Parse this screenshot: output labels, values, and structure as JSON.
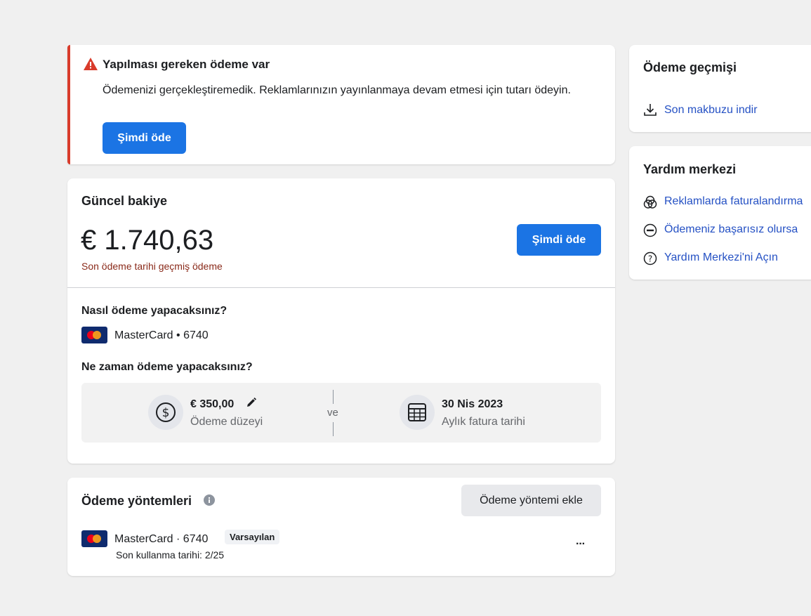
{
  "alert": {
    "title": "Yapılması gereken ödeme var",
    "message": "Ödemenizi gerçekleştiremedik. Reklamlarınızın yayınlanmaya devam etmesi için tutarı ödeyin.",
    "button": "Şimdi öde",
    "accent_color": "#d93b2b"
  },
  "balance": {
    "title": "Güncel bakiye",
    "amount": "€ 1.740,63",
    "status": "Son ödeme tarihi geçmiş ödeme",
    "button": "Şimdi öde",
    "how_title": "Nasıl ödeme yapacaksınız?",
    "card_label": "MasterCard • 6740",
    "when_title": "Ne zaman ödeme yapacaksınız?",
    "threshold_value": "€ 350,00",
    "threshold_label": "Ödeme düzeyi",
    "separator": "ve",
    "billing_date_value": "30 Nis 2023",
    "billing_date_label": "Aylık fatura tarihi"
  },
  "methods": {
    "title": "Ödeme yöntemleri",
    "add_button": "Ödeme yöntemi ekle",
    "card_label": "MasterCard · 6740",
    "default_badge": "Varsayılan",
    "expiry": "Son kullanma tarihi: 2/25",
    "more": "···"
  },
  "history": {
    "title": "Ödeme geçmişi",
    "download_link": "Son makbuzu indir"
  },
  "help": {
    "title": "Yardım merkezi",
    "links": [
      {
        "label": "Reklamlarda faturalandırma",
        "icon": "venn-icon"
      },
      {
        "label": "Ödemeniz başarısız olursa",
        "icon": "minus-circle-icon"
      },
      {
        "label": "Yardım Merkezi'ni Açın",
        "icon": "question-circle-icon"
      }
    ]
  }
}
